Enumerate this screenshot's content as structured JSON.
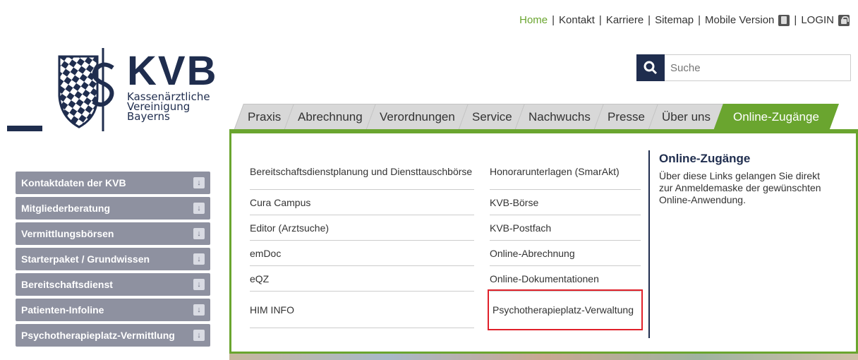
{
  "topnav": {
    "home": "Home",
    "kontakt": "Kontakt",
    "karriere": "Karriere",
    "sitemap": "Sitemap",
    "mobile": "Mobile Version",
    "login": "LOGIN",
    "sep": "|"
  },
  "logo": {
    "name": "KVB",
    "line1": "Kassenärztliche",
    "line2": "Vereinigung",
    "line3": "Bayerns"
  },
  "search": {
    "placeholder": "Suche"
  },
  "tabs": [
    "Praxis",
    "Abrechnung",
    "Verordnungen",
    "Service",
    "Nachwuchs",
    "Presse",
    "Über uns",
    "Online-Zugänge"
  ],
  "active_tab": "Online-Zugänge",
  "panel": {
    "col1": [
      "Bereitschaftsdienstplanung und Diensttauschbörse",
      "Cura Campus",
      "Editor (Arztsuche)",
      "emDoc",
      "eQZ",
      "HIM INFO"
    ],
    "col2": [
      "Honorarunterlagen (SmarAkt)",
      "KVB-Börse",
      "KVB-Postfach",
      "Online-Abrechnung",
      "Online-Dokumentationen",
      "Psychotherapieplatz-Verwaltung"
    ],
    "info_title": "Online-Zugänge",
    "info_text": "Über diese Links gelangen Sie direkt zur Anmeldemaske der gewünschten Online-Anwendung."
  },
  "sidebar": [
    "Kontaktdaten der KVB",
    "Mitgliederberatung",
    "Vermittlungsbörsen",
    "Starterpaket / Grundwissen",
    "Bereitschaftsdienst",
    "Patienten-Infoline",
    "Psychotherapieplatz-Vermittlung"
  ],
  "colors": {
    "accent": "#6aa52f",
    "brand": "#1f2d4e",
    "sidebar": "#8e91a0",
    "highlight": "#e0202a"
  }
}
